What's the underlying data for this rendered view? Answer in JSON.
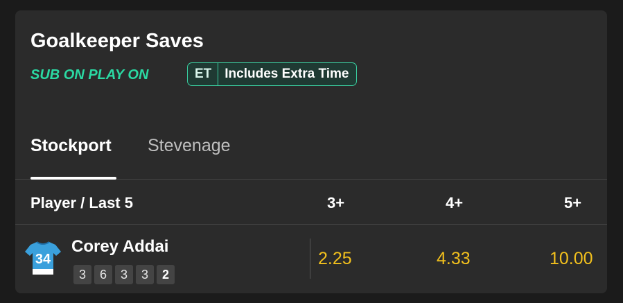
{
  "market": {
    "title": "Goalkeeper Saves",
    "sub_on_label": "SUB ON PLAY ON",
    "badge": {
      "code": "ET",
      "text": "Includes Extra Time"
    }
  },
  "tabs": [
    {
      "label": "Stockport",
      "active": true
    },
    {
      "label": "Stevenage",
      "active": false
    }
  ],
  "table": {
    "headers": [
      "Player / Last 5",
      "3+",
      "4+",
      "5+"
    ],
    "rows": [
      {
        "shirt_number": "34",
        "name": "Corey Addai",
        "last5": [
          "3",
          "6",
          "3",
          "3",
          "2"
        ],
        "odds": [
          "2.25",
          "4.33",
          "10.00"
        ]
      }
    ]
  },
  "colors": {
    "background": "#1b1b1b",
    "card": "#2b2b2b",
    "accent_green": "#2bd9a3",
    "odds_yellow": "#f2c01d",
    "shirt_blue": "#3aa0dc"
  }
}
